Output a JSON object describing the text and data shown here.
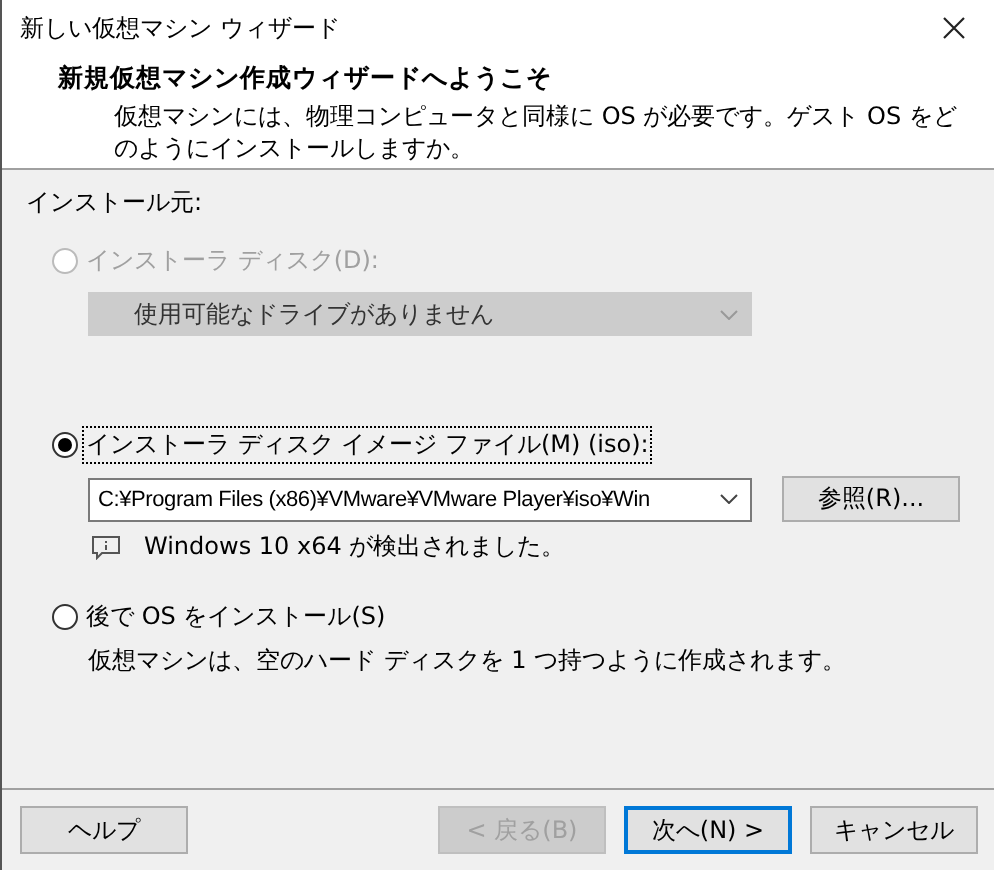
{
  "window": {
    "title": "新しい仮想マシン ウィザード"
  },
  "header": {
    "title": "新規仮想マシン作成ウィザードへようこそ",
    "description": "仮想マシンには、物理コンピュータと同様に OS が必要です。ゲスト OS をどのようにインストールしますか。"
  },
  "section_label": "インストール元:",
  "options": [
    {
      "kind": "dropdown",
      "label": "インストーラ ディスク(D):",
      "selected": false,
      "disabled": true,
      "value": "使用可能なドライブがありません"
    },
    {
      "kind": "file",
      "label": "インストーラ ディスク イメージ ファイル(M) (iso):",
      "selected": true,
      "disabled": false,
      "value": "C:¥Program Files (x86)¥VMware¥VMware Player¥iso¥Win",
      "browse_button": "参照(R)...",
      "info": "Windows 10 x64 が検出されました。"
    },
    {
      "kind": "later",
      "label": "後で OS をインストール(S)",
      "selected": false,
      "disabled": false,
      "note": "仮想マシンは、空のハード ディスクを 1 つ持つように作成されます。"
    }
  ],
  "buttons": [
    {
      "label": "ヘルプ",
      "disabled": false,
      "default": false
    },
    {
      "label": "< 戻る(B)",
      "disabled": true,
      "default": false
    },
    {
      "label": "次へ(N) >",
      "disabled": false,
      "default": true
    },
    {
      "label": "キャンセル",
      "disabled": false,
      "default": false
    }
  ]
}
